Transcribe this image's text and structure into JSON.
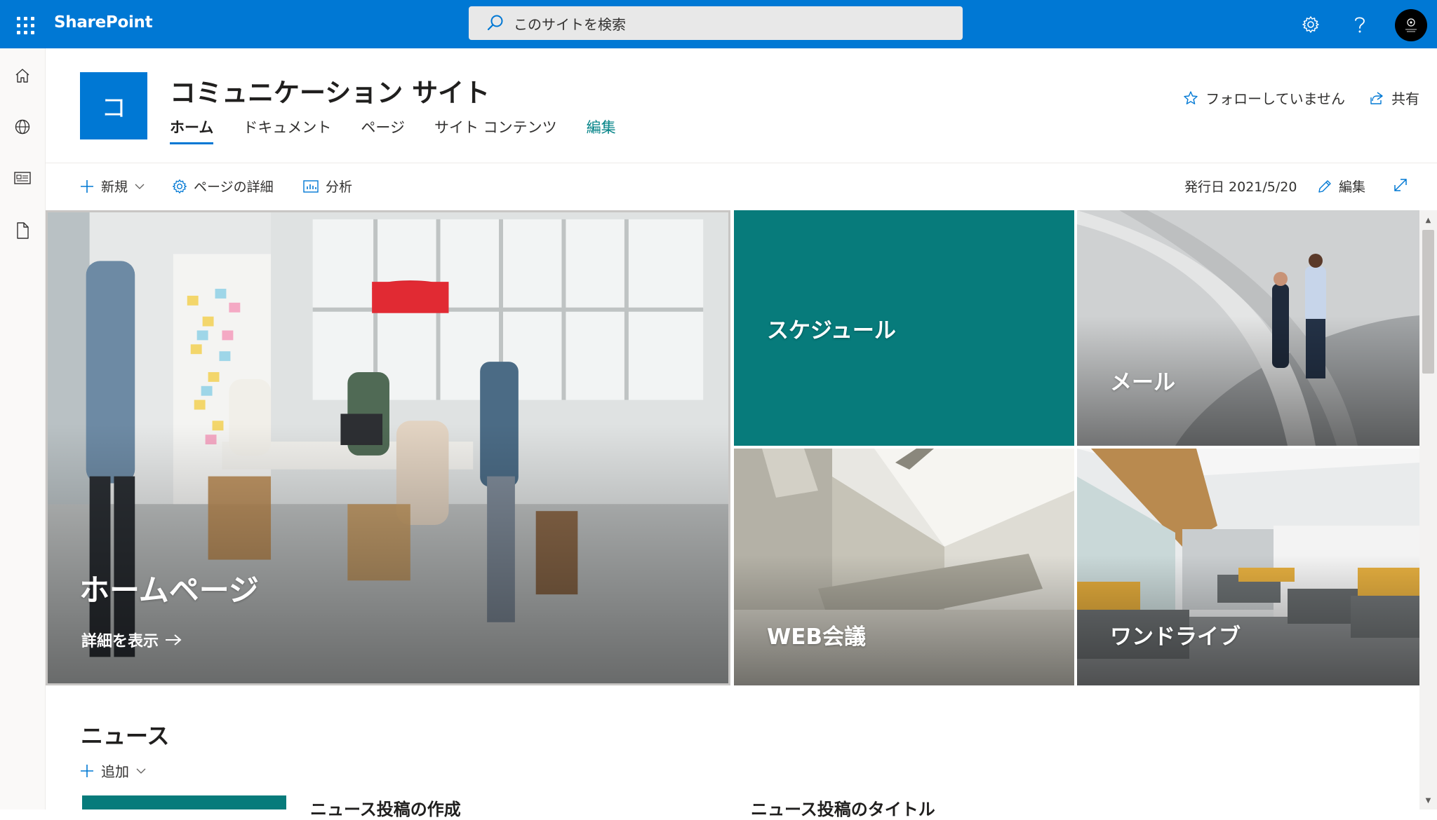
{
  "suite": {
    "brand": "SharePoint",
    "search_placeholder": "このサイトを検索"
  },
  "site": {
    "logo_letter": "コ",
    "title": "コミュニケーション サイト",
    "nav": [
      "ホーム",
      "ドキュメント",
      "ページ",
      "サイト コンテンツ",
      "編集"
    ],
    "follow_label": "フォローしていません",
    "share_label": "共有"
  },
  "commands": {
    "new_label": "新規",
    "page_details_label": "ページの詳細",
    "analytics_label": "分析",
    "published_label": "発行日 2021/5/20",
    "edit_label": "編集"
  },
  "hero": {
    "main_title": "ホームページ",
    "more_label": "詳細を表示",
    "tiles": [
      "スケジュール",
      "メール",
      "WEB会議",
      "ワンドライブ"
    ]
  },
  "news": {
    "title": "ニュース",
    "add_label": "追加",
    "items": [
      "ニュース投稿の作成",
      "ニュース投稿のタイトル"
    ]
  },
  "colors": {
    "suite_bar": "#0078d4",
    "teal_accent": "#077b7b"
  }
}
